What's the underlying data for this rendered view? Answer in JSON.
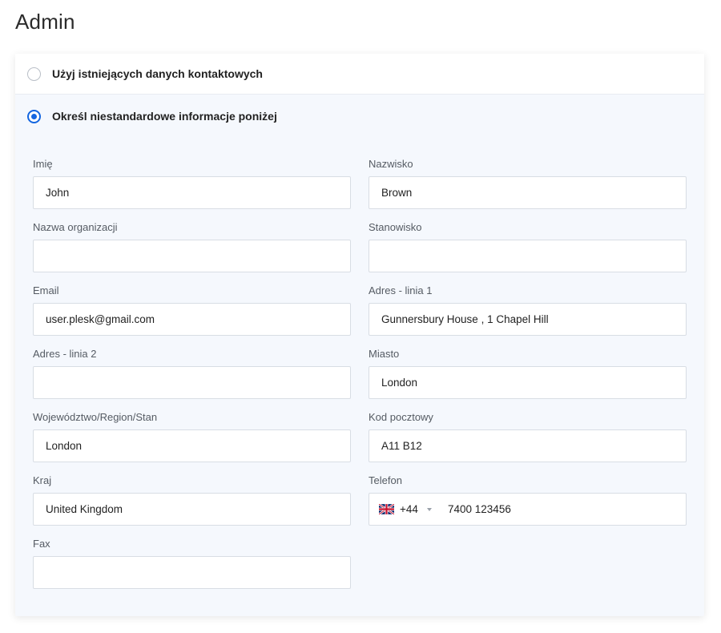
{
  "page": {
    "title": "Admin"
  },
  "options": {
    "existing": {
      "label": "Użyj istniejących danych kontaktowych",
      "selected": false
    },
    "custom": {
      "label": "Określ niestandardowe informacje poniżej",
      "selected": true
    }
  },
  "fields": {
    "first_name": {
      "label": "Imię",
      "value": "John"
    },
    "last_name": {
      "label": "Nazwisko",
      "value": "Brown"
    },
    "organization": {
      "label": "Nazwa organizacji",
      "value": ""
    },
    "position": {
      "label": "Stanowisko",
      "value": ""
    },
    "email": {
      "label": "Email",
      "value": "user.plesk@gmail.com"
    },
    "address1": {
      "label": "Adres - linia 1",
      "value": "Gunnersbury House , 1 Chapel Hill"
    },
    "address2": {
      "label": "Adres - linia 2",
      "value": ""
    },
    "city": {
      "label": "Miasto",
      "value": "London"
    },
    "state": {
      "label": "Województwo/Region/Stan",
      "value": "London"
    },
    "postal_code": {
      "label": "Kod pocztowy",
      "value": "A11 B12"
    },
    "country": {
      "label": "Kraj",
      "value": "United Kingdom"
    },
    "phone": {
      "label": "Telefon",
      "flag_icon": "uk-flag-icon",
      "dial_code": "+44",
      "number": "7400 123456"
    },
    "fax": {
      "label": "Fax",
      "value": ""
    }
  },
  "colors": {
    "accent": "#1466e0",
    "card_background": "#f5f8fd"
  }
}
